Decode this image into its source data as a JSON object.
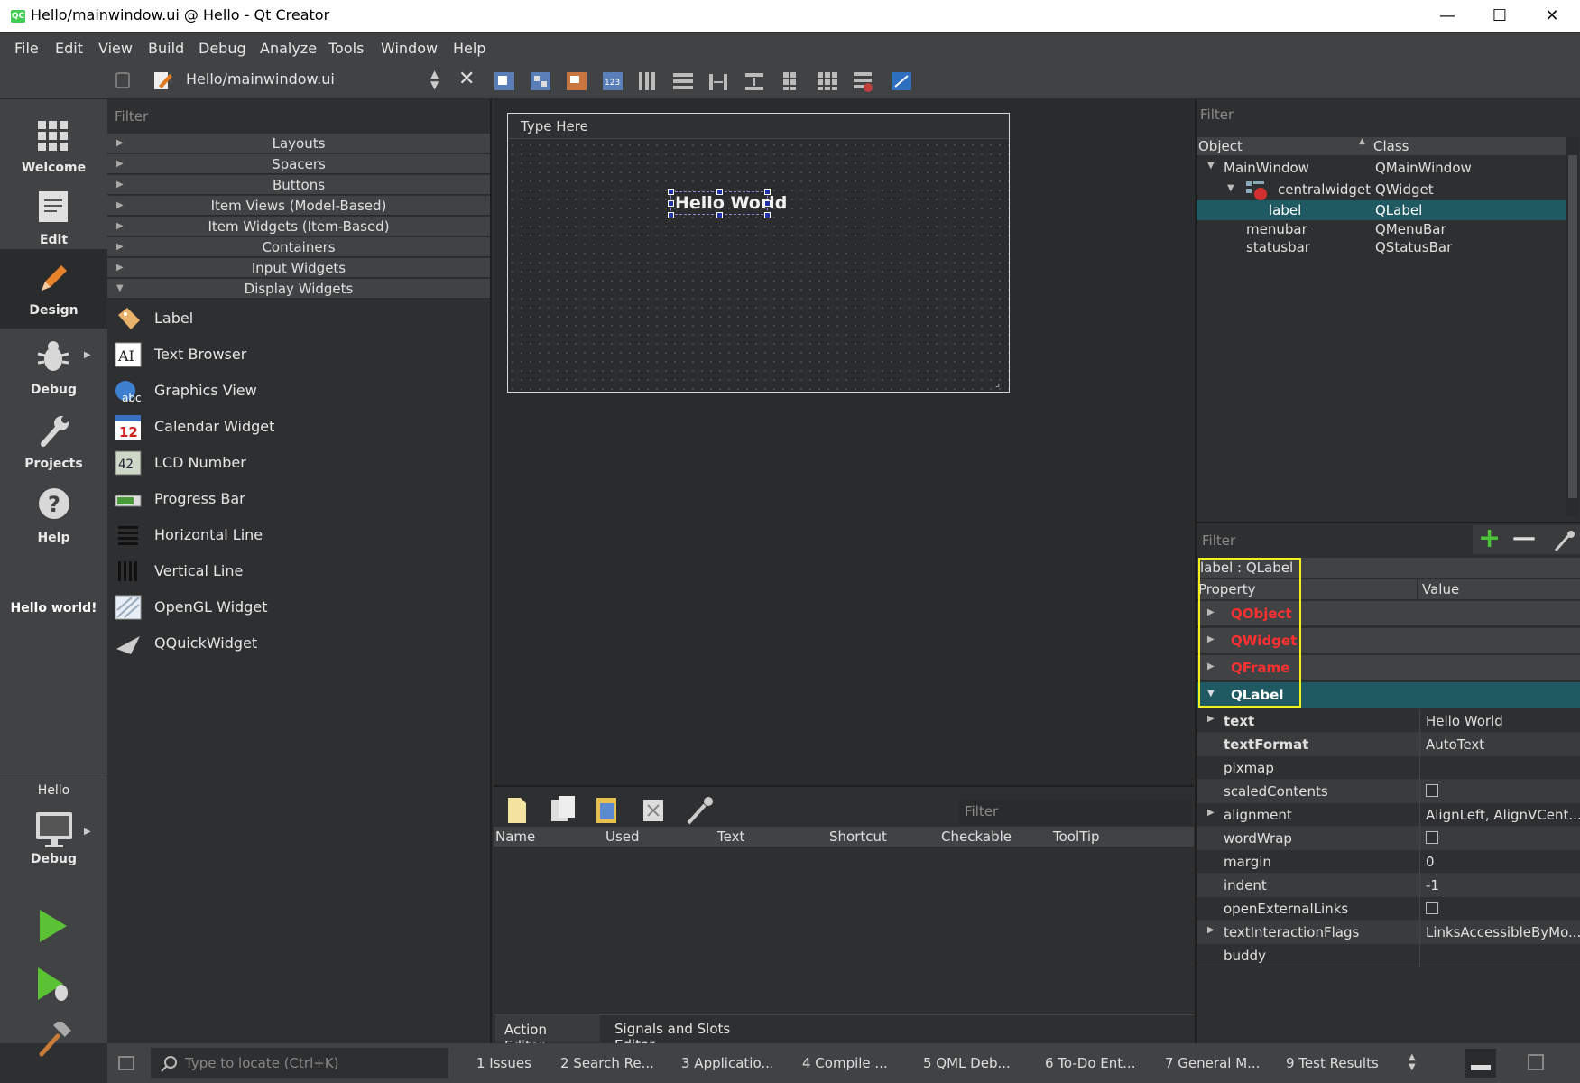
{
  "window": {
    "title": "Hello/mainwindow.ui @ Hello - Qt Creator",
    "app_icon": "qc-icon",
    "controls": [
      "minimize-icon",
      "maximize-icon",
      "close-icon"
    ]
  },
  "menu": [
    "File",
    "Edit",
    "View",
    "Build",
    "Debug",
    "Analyze",
    "Tools",
    "Window",
    "Help"
  ],
  "toolbar": {
    "file": "Hello/mainwindow.ui"
  },
  "modes": [
    {
      "label": "Welcome",
      "icon": "grid-icon"
    },
    {
      "label": "Edit",
      "icon": "document-icon"
    },
    {
      "label": "Design",
      "icon": "pencil-icon",
      "active": true
    },
    {
      "label": "Debug",
      "icon": "bug-icon"
    },
    {
      "label": "Projects",
      "icon": "wrench-icon"
    },
    {
      "label": "Help",
      "icon": "question-icon"
    }
  ],
  "project_label": "Hello world!",
  "kit": {
    "project": "Hello",
    "config": "Debug"
  },
  "widget_box": {
    "filter": "Filter",
    "categories": [
      "Layouts",
      "Spacers",
      "Buttons",
      "Item Views (Model-Based)",
      "Item Widgets (Item-Based)",
      "Containers",
      "Input Widgets",
      "Display Widgets"
    ],
    "items": [
      "Label",
      "Text Browser",
      "Graphics View",
      "Calendar Widget",
      "LCD Number",
      "Progress Bar",
      "Horizontal Line",
      "Vertical Line",
      "OpenGL Widget",
      "QQuickWidget"
    ]
  },
  "form": {
    "menu_placeholder": "Type Here",
    "label_text": "Hello World"
  },
  "action_editor": {
    "filter": "Filter",
    "columns": [
      "Name",
      "Used",
      "Text",
      "Shortcut",
      "Checkable",
      "ToolTip"
    ],
    "tabs": [
      "Action Editor",
      "Signals and Slots Editor"
    ]
  },
  "object_inspector": {
    "filter": "Filter",
    "columns": [
      "Object",
      "Class"
    ],
    "rows": [
      {
        "object": "MainWindow",
        "class": "QMainWindow"
      },
      {
        "object": "centralwidget",
        "class": "QWidget"
      },
      {
        "object": "label",
        "class": "QLabel"
      },
      {
        "object": "menubar",
        "class": "QMenuBar"
      },
      {
        "object": "statusbar",
        "class": "QStatusBar"
      }
    ]
  },
  "property_editor": {
    "filter": "Filter",
    "object_label": "label : QLabel",
    "columns": [
      "Property",
      "Value"
    ],
    "groups": [
      "QObject",
      "QWidget",
      "QFrame",
      "QLabel"
    ],
    "properties": [
      {
        "name": "text",
        "value": "Hello World"
      },
      {
        "name": "textFormat",
        "value": "AutoText"
      },
      {
        "name": "pixmap",
        "value": ""
      },
      {
        "name": "scaledContents",
        "value": ""
      },
      {
        "name": "alignment",
        "value": "AlignLeft, AlignVCent..."
      },
      {
        "name": "wordWrap",
        "value": ""
      },
      {
        "name": "margin",
        "value": "0"
      },
      {
        "name": "indent",
        "value": "-1"
      },
      {
        "name": "openExternalLinks",
        "value": ""
      },
      {
        "name": "textInteractionFlags",
        "value": "LinksAccessibleByMo..."
      },
      {
        "name": "buddy",
        "value": ""
      }
    ]
  },
  "statusbar": {
    "locate_placeholder": "Type to locate (Ctrl+K)",
    "panes": [
      "1  Issues",
      "2  Search Re...",
      "3  Applicatio...",
      "4  Compile ...",
      "5  QML Deb...",
      "6  To-Do Ent...",
      "7  General M...",
      "9  Test Results"
    ]
  },
  "colors": {
    "accent_selection": "#1f5a63",
    "group_red": "#ff3030",
    "highlight_box": "#f2f21a",
    "run_green": "#5bc236"
  }
}
